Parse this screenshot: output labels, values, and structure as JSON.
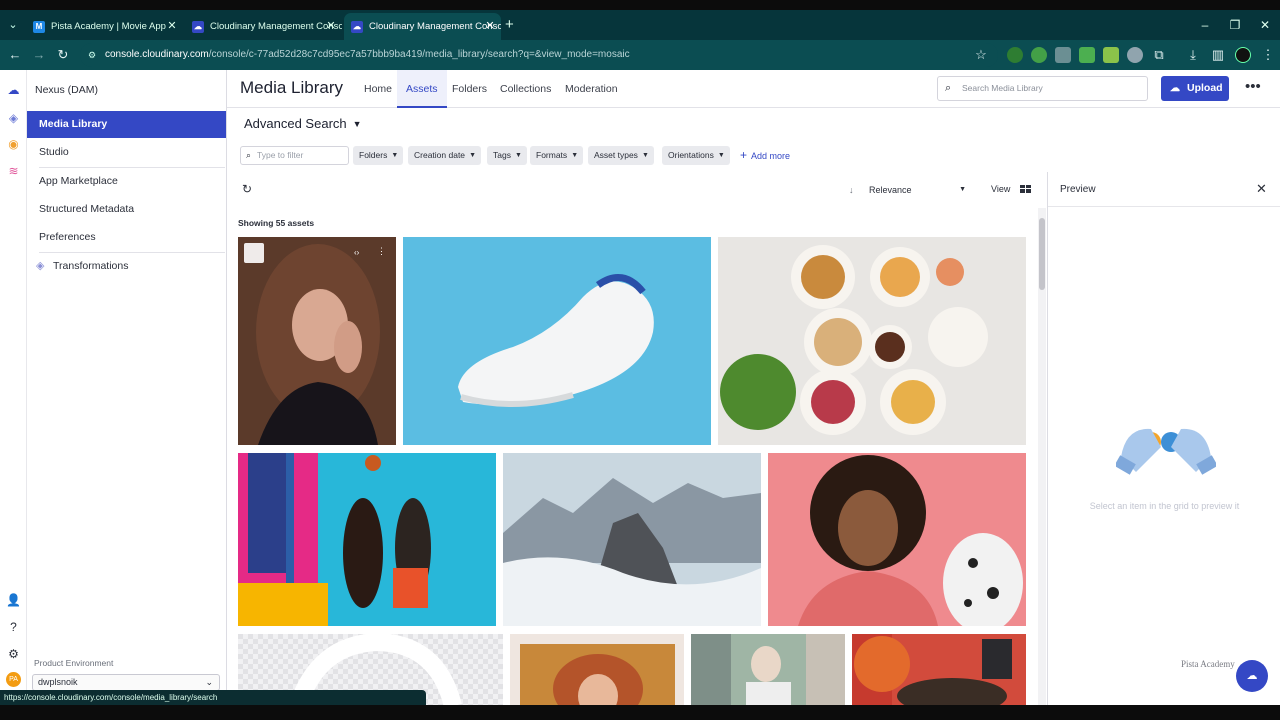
{
  "browser": {
    "tabs": [
      {
        "title": "Pista Academy | Movie App",
        "favicon": "M",
        "active": false
      },
      {
        "title": "Cloudinary Management Console",
        "favicon": "cloud",
        "active": false
      },
      {
        "title": "Cloudinary Management Console",
        "favicon": "cloud",
        "active": true
      }
    ],
    "url_domain": "console.cloudinary.com",
    "url_path": "/console/c-77ad52d28c7cd95ec7a57bbb9ba419/media_library/search?q=&view_mode=mosaic",
    "status_url": "https://console.cloudinary.com/console/media_library/search"
  },
  "sidebar": {
    "brand": "Nexus (DAM)",
    "items": [
      {
        "label": "Media Library",
        "active": true
      },
      {
        "label": "Studio",
        "active": false
      },
      {
        "label": "App Marketplace",
        "active": false
      },
      {
        "label": "Structured Metadata",
        "active": false
      },
      {
        "label": "Preferences",
        "active": false
      },
      {
        "label": "Transformations",
        "active": false
      }
    ],
    "product_env_label": "Product Environment",
    "product_env_value": "dwplsnoik",
    "avatar_initials": "PA"
  },
  "header": {
    "title": "Media Library",
    "tabs": [
      "Home",
      "Assets",
      "Folders",
      "Collections",
      "Moderation"
    ],
    "active_tab": "Assets",
    "search_placeholder": "Search Media Library",
    "upload_label": "Upload"
  },
  "search": {
    "title": "Advanced Search",
    "filter_placeholder": "Type to filter",
    "chips": [
      "Folders",
      "Creation date",
      "Tags",
      "Formats",
      "Asset types",
      "Orientations"
    ],
    "add_more": "Add more",
    "sort": "Relevance",
    "view_label": "View",
    "showing": "Showing 55 assets"
  },
  "preview": {
    "title": "Preview",
    "message": "Select an item in the grid to preview it"
  },
  "watermark": "Pista Academy",
  "colors": {
    "accent": "#3448c5",
    "chrome_dark": "#06353b",
    "chrome_bar": "#0b4d52"
  }
}
